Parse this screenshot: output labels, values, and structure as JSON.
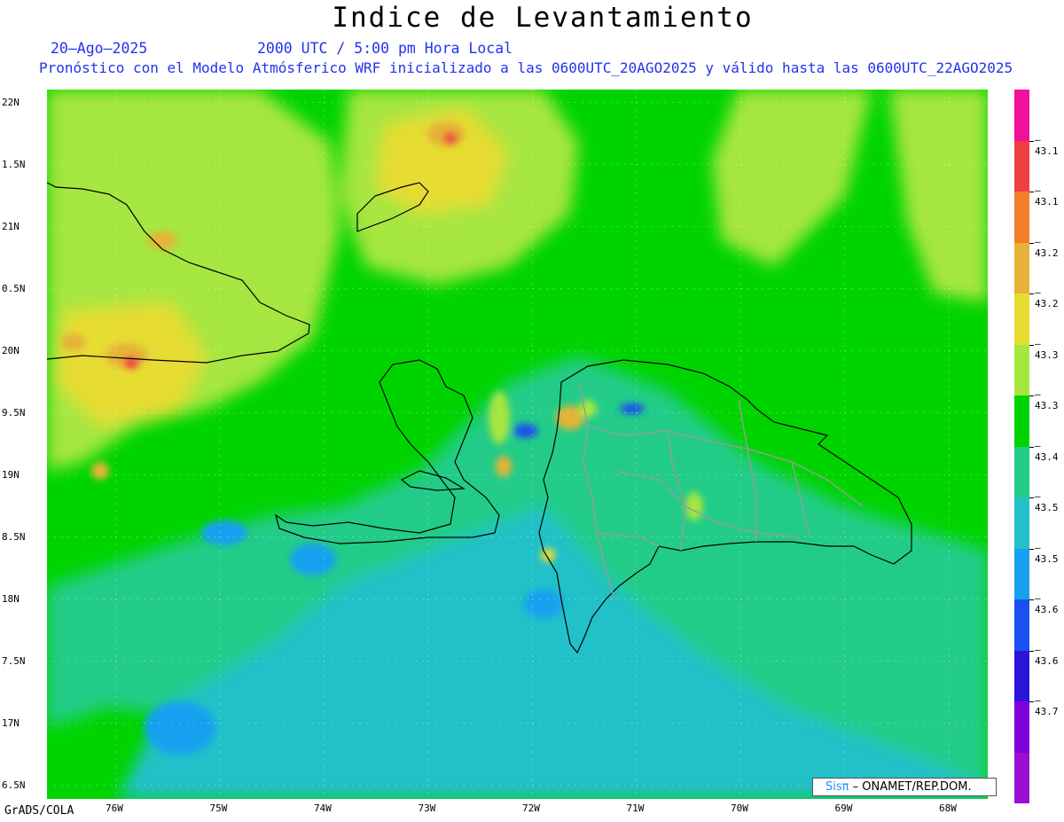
{
  "title": "Indice de Levantamiento",
  "subtitle_date": "20–Ago–2025",
  "subtitle_time": "2000 UTC / 5:00 pm Hora Local",
  "description": "Pronóstico con el Modelo Atmósferico WRF inicializado a las 0600UTC_20AGO2025 y válido hasta las  0600UTC_22AGO2025",
  "footer": "GrADS/COLA",
  "credit": {
    "brand": "Sisπ",
    "org": " – ONAMET/REP.DOM."
  },
  "lat_labels": [
    "22N",
    "1.5N",
    "21N",
    "0.5N",
    "20N",
    "9.5N",
    "19N",
    "8.5N",
    "18N",
    "7.5N",
    "17N",
    "6.5N"
  ],
  "lon_labels": [
    "76W",
    "75W",
    "74W",
    "73W",
    "72W",
    "71W",
    "70W",
    "69W",
    "68W"
  ],
  "colorbar": {
    "colors": [
      "#f0109a",
      "#ee4040",
      "#f07f28",
      "#e6b238",
      "#e6dc32",
      "#a6e640",
      "#00d400",
      "#22cc88",
      "#22c0c8",
      "#18a0f0",
      "#1a50f0",
      "#2a14d8",
      "#8000d8",
      "#9a10d0"
    ],
    "labels": [
      "–43.1",
      "–43.1",
      "–43.2",
      "–43.2",
      "–43.3",
      "–43.3",
      "–43.4",
      "–43.5",
      "–43.5",
      "–43.6",
      "–43.6",
      "–43.7"
    ]
  },
  "map_colors": {
    "green": "#00d400",
    "lightgreen": "#a6e640",
    "yellow": "#e6dc32",
    "orange": "#e6b238",
    "red": "#ee4040",
    "teal": "#22cc88",
    "cyan": "#22c0c8",
    "blue": "#18a0f0",
    "darkblue": "#1a50f0"
  }
}
